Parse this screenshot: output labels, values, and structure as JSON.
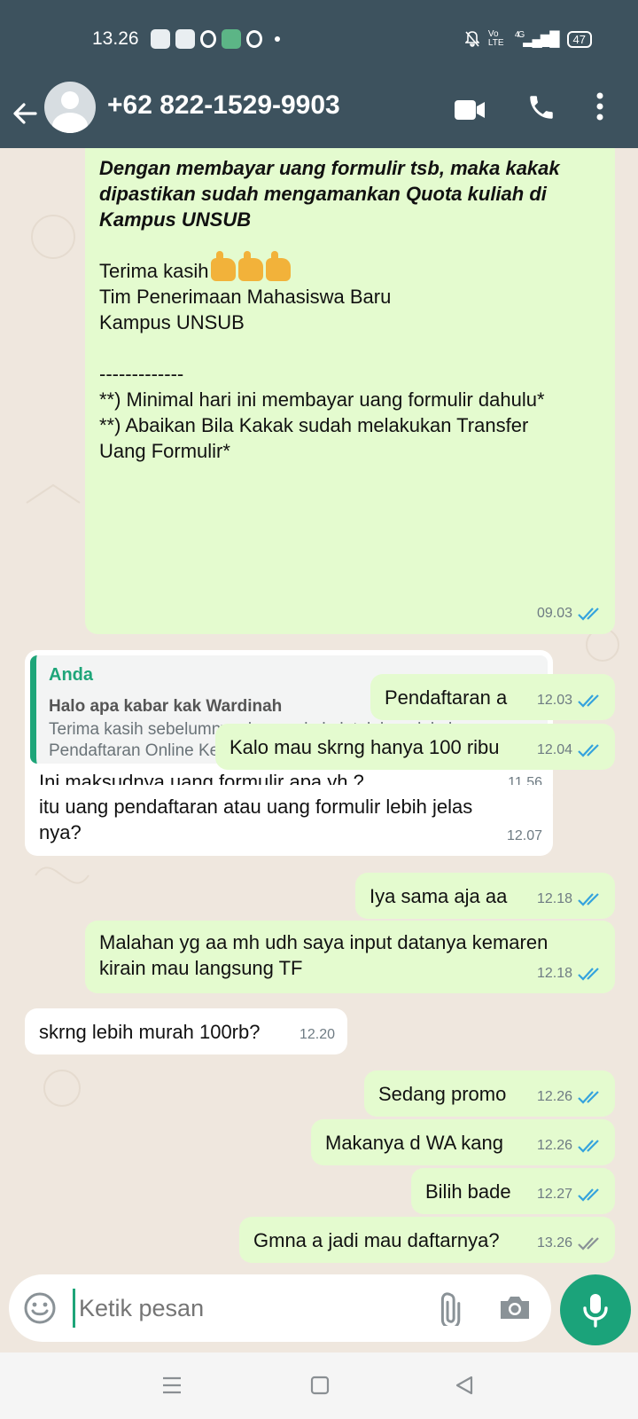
{
  "status_bar": {
    "time": "13.26",
    "network": "4G",
    "volte": "Vo LTE",
    "battery": "47"
  },
  "header": {
    "contact_name": "+62 822-1529-9903"
  },
  "messages": {
    "long": {
      "bold_text": "Dengan membayar uang formulir tsb, maka kakak dipastikan sudah mengamankan Quota kuliah di Kampus UNSUB",
      "thanks": "Terima kasih",
      "signature": "Tim Penerimaan Mahasiswa Baru\nKampus UNSUB",
      "divider": "-------------",
      "note1": "**) Minimal hari ini membayar uang formulir dahulu*",
      "note2": "**) Abaikan Bila Kakak sudah melakukan Transfer Uang Formulir*",
      "time": "09.03"
    },
    "reply": {
      "quote_author": "Anda",
      "quote_title": "Halo apa kabar kak Wardinah",
      "quote_line1": "Terima kasih sebelumnya, karena kakak telah melakukan",
      "quote_line2": "Pendaftaran Online Kelas Karyawan Via Facebook di Kam...",
      "text": "Ini maksudnya uang formulir apa yh ?",
      "time": "11.56"
    },
    "m1": {
      "text": "Pendaftaran a",
      "time": "12.03"
    },
    "m2": {
      "text": "Kalo mau skrng hanya 100 ribu",
      "time": "12.04"
    },
    "m3": {
      "text": "itu uang pendaftaran atau uang formulir lebih jelas nya?",
      "time": "12.07"
    },
    "m4": {
      "text": "Iya sama aja aa",
      "time": "12.18"
    },
    "m5": {
      "text": "Malahan yg aa mh udh saya input datanya kemaren kirain mau langsung TF",
      "time": "12.18"
    },
    "m6": {
      "text": "skrng lebih murah 100rb?",
      "time": "12.20"
    },
    "m7": {
      "text": "Sedang promo",
      "time": "12.26"
    },
    "m8": {
      "text": "Makanya d WA kang",
      "time": "12.26"
    },
    "m9": {
      "text": "Bilih bade",
      "time": "12.27"
    },
    "m10": {
      "text": "Gmna a jadi mau daftarnya?",
      "time": "13.26"
    }
  },
  "input": {
    "placeholder": "Ketik pesan"
  },
  "colors": {
    "header": "#3d525e",
    "outgoing": "#e4fbcf",
    "incoming": "#ffffff",
    "accent": "#1ba37a",
    "read_ticks": "#35a3dd",
    "sent_ticks": "#8a9297"
  },
  "icons": [
    "back-arrow-icon",
    "avatar-icon",
    "video-call-icon",
    "phone-icon",
    "more-vert-icon",
    "emoji-icon",
    "attach-icon",
    "camera-icon",
    "mic-icon",
    "read-ticks-icon",
    "sent-ticks-icon"
  ]
}
